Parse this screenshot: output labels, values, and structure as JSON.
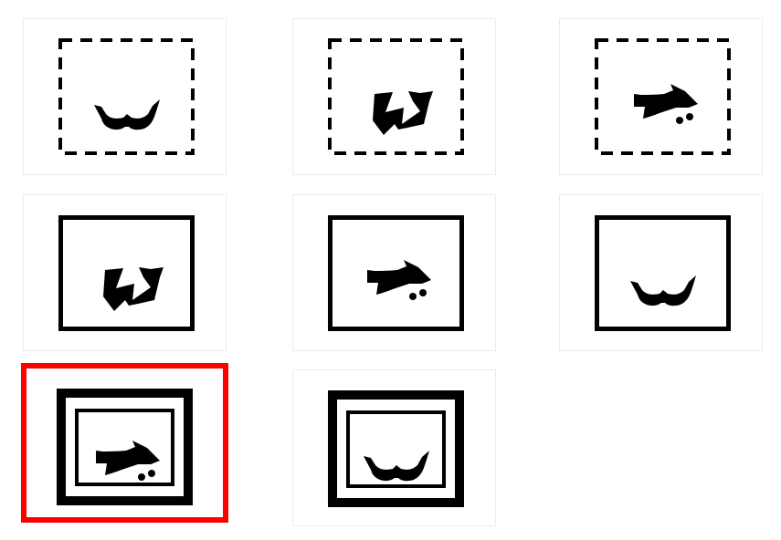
{
  "puzzle": {
    "tiles": [
      {
        "frame": "dashed",
        "shape": "wings-icon",
        "selected": false
      },
      {
        "frame": "dashed",
        "shape": "zigzag-icon",
        "selected": false
      },
      {
        "frame": "dashed",
        "shape": "arrow-icon",
        "selected": false
      },
      {
        "frame": "solid",
        "shape": "zigzag-icon",
        "selected": false
      },
      {
        "frame": "solid",
        "shape": "arrow-icon",
        "selected": false
      },
      {
        "frame": "solid",
        "shape": "wings-icon",
        "selected": false
      },
      {
        "frame": "double",
        "shape": "arrow-icon",
        "selected": true
      },
      {
        "frame": "double",
        "shape": "wings-icon",
        "selected": false
      }
    ],
    "colors": {
      "selection": "#ff0000",
      "ink": "#000000",
      "tile_border": "#ebebeb"
    }
  }
}
